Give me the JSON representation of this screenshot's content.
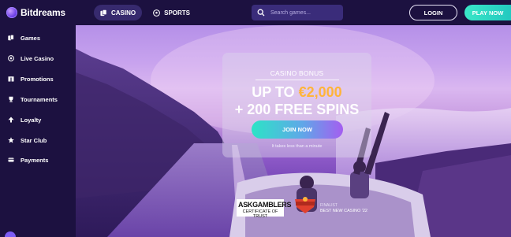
{
  "brand": {
    "name": "Bitdreams"
  },
  "nav_tabs": [
    {
      "label": "CASINO",
      "icon": "cards-icon",
      "active": true
    },
    {
      "label": "SPORTS",
      "icon": "soccer-ball-icon",
      "active": false
    }
  ],
  "search": {
    "placeholder": "Search games..."
  },
  "auth": {
    "login_label": "LOGIN",
    "play_label": "PLAY NOW"
  },
  "sidebar": {
    "items": [
      {
        "label": "Games",
        "icon": "games-icon"
      },
      {
        "label": "Live Casino",
        "icon": "live-casino-icon"
      },
      {
        "label": "Promotions",
        "icon": "gift-icon"
      },
      {
        "label": "Tournaments",
        "icon": "trophy-icon"
      },
      {
        "label": "Loyalty",
        "icon": "arrow-up-icon"
      },
      {
        "label": "Star Club",
        "icon": "star-icon"
      },
      {
        "label": "Payments",
        "icon": "wallet-icon"
      }
    ]
  },
  "hero": {
    "eyebrow": "CASINO BONUS",
    "line1_prefix": "UP TO ",
    "line1_amount": "€2,000",
    "line2": "+ 200 FREE SPINS",
    "cta_label": "JOIN NOW",
    "note": "It takes less than a minute"
  },
  "badges": {
    "askgamblers_title": "ASKGAMBLERS",
    "askgamblers_sub": "CERTIFICATE OF TRUST",
    "award_small": "FINALIST",
    "award_title": "BEST NEW CASINO '22"
  },
  "colors": {
    "accent_teal": "#3ae6c7",
    "bonus_orange": "#ffb43a",
    "nav_bg": "#1c1140"
  }
}
